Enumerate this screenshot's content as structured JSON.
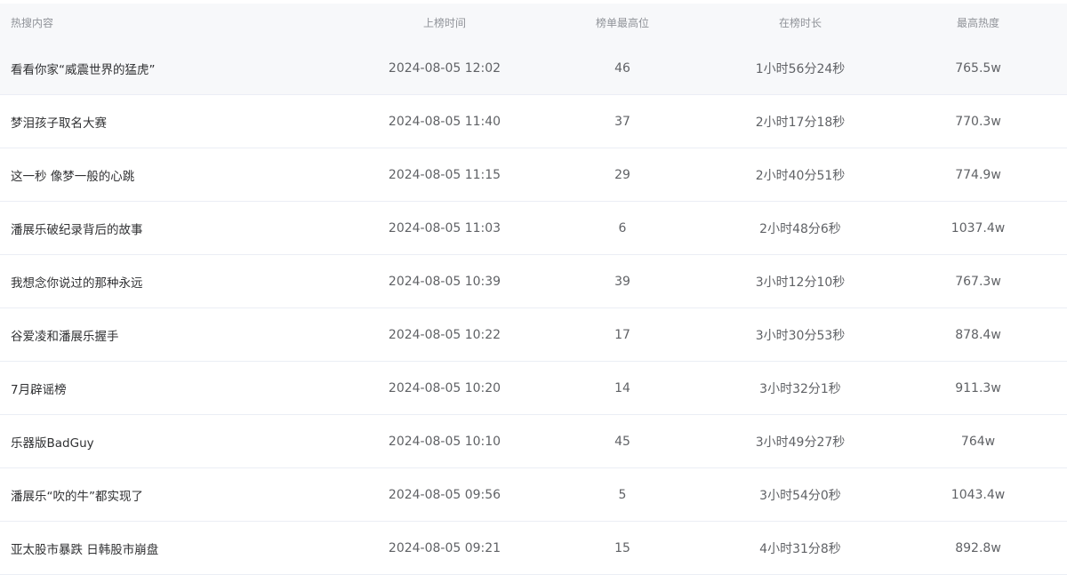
{
  "table": {
    "headers": {
      "title": "热搜内容",
      "time": "上榜时间",
      "rank": "榜单最高位",
      "duration": "在榜时长",
      "heat": "最高热度"
    },
    "rows": [
      {
        "title": "看看你家“威震世界的猛虎”",
        "time": "2024-08-05 12:02",
        "rank": "46",
        "duration": "1小时56分24秒",
        "heat": "765.5w"
      },
      {
        "title": "梦泪孩子取名大赛",
        "time": "2024-08-05 11:40",
        "rank": "37",
        "duration": "2小时17分18秒",
        "heat": "770.3w"
      },
      {
        "title": "这一秒 像梦一般的心跳",
        "time": "2024-08-05 11:15",
        "rank": "29",
        "duration": "2小时40分51秒",
        "heat": "774.9w"
      },
      {
        "title": "潘展乐破纪录背后的故事",
        "time": "2024-08-05 11:03",
        "rank": "6",
        "duration": "2小时48分6秒",
        "heat": "1037.4w"
      },
      {
        "title": "我想念你说过的那种永远",
        "time": "2024-08-05 10:39",
        "rank": "39",
        "duration": "3小时12分10秒",
        "heat": "767.3w"
      },
      {
        "title": "谷爱凌和潘展乐握手",
        "time": "2024-08-05 10:22",
        "rank": "17",
        "duration": "3小时30分53秒",
        "heat": "878.4w"
      },
      {
        "title": "7月辟谣榜",
        "time": "2024-08-05 10:20",
        "rank": "14",
        "duration": "3小时32分1秒",
        "heat": "911.3w"
      },
      {
        "title": "乐器版BadGuy",
        "time": "2024-08-05 10:10",
        "rank": "45",
        "duration": "3小时49分27秒",
        "heat": "764w"
      },
      {
        "title": "潘展乐“吹的牛”都实现了",
        "time": "2024-08-05 09:56",
        "rank": "5",
        "duration": "3小时54分0秒",
        "heat": "1043.4w"
      },
      {
        "title": "亚太股市暴跌 日韩股市崩盘",
        "time": "2024-08-05 09:21",
        "rank": "15",
        "duration": "4小时31分8秒",
        "heat": "892.8w"
      }
    ]
  }
}
